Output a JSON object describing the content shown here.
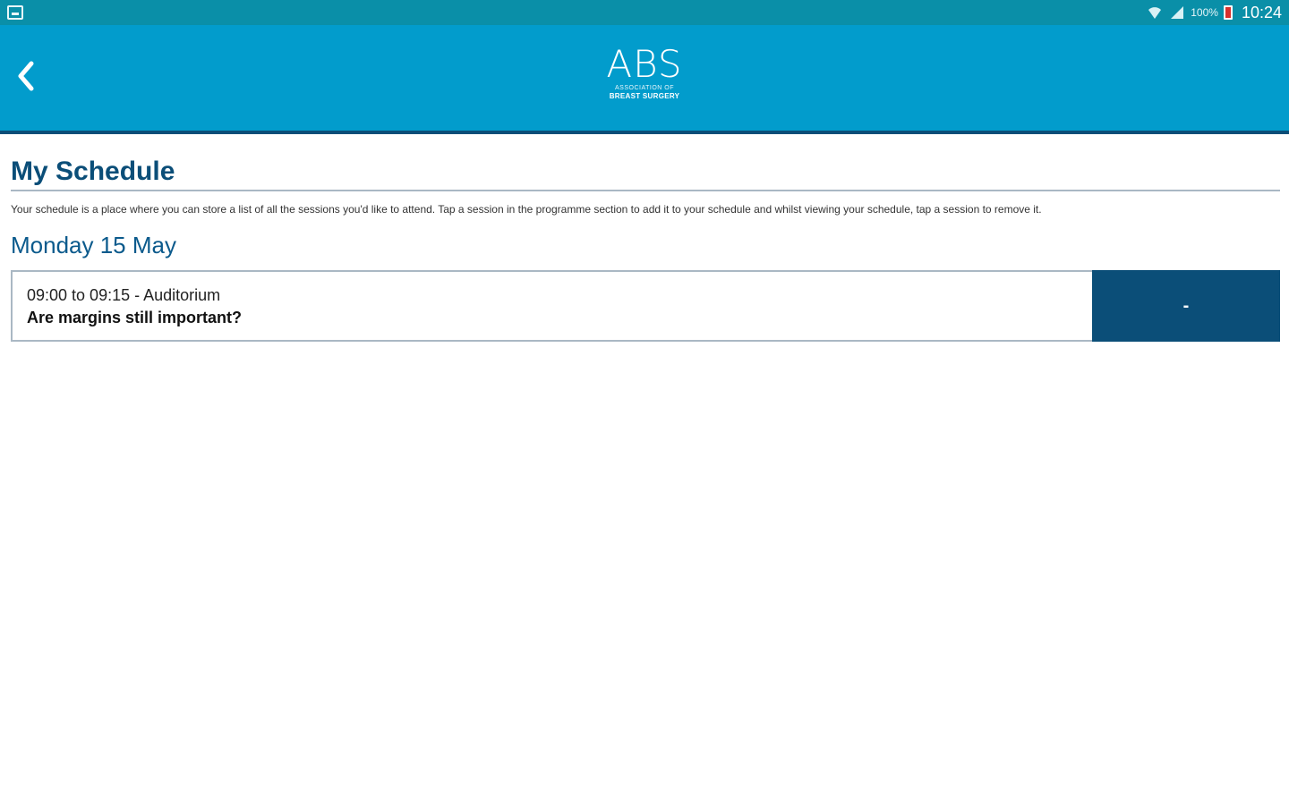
{
  "status_bar": {
    "notification_icon": "notification-icon",
    "battery_pct": "100%",
    "time": "10:24"
  },
  "header": {
    "back_icon": "chevron-left-icon",
    "logo": {
      "mark": "ABS",
      "line1": "ASSOCIATION OF",
      "line2": "BREAST SURGERY"
    }
  },
  "main": {
    "title": "My Schedule",
    "intro": "Your schedule is a place where you can store a list of all the sessions you'd like to attend. Tap a session in the programme section to add it to your schedule and whilst viewing your schedule, tap a session to remove it.",
    "days": [
      {
        "heading": "Monday 15 May",
        "sessions": [
          {
            "time": "09:00 to 09:15 - Auditorium",
            "title": "Are margins still important?",
            "action_label": "-"
          }
        ]
      }
    ]
  },
  "colors": {
    "status_bar": "#0a8fa8",
    "header": "#029ccc",
    "accent_dark": "#0b4e78",
    "heading_blue": "#0b5a8c"
  }
}
